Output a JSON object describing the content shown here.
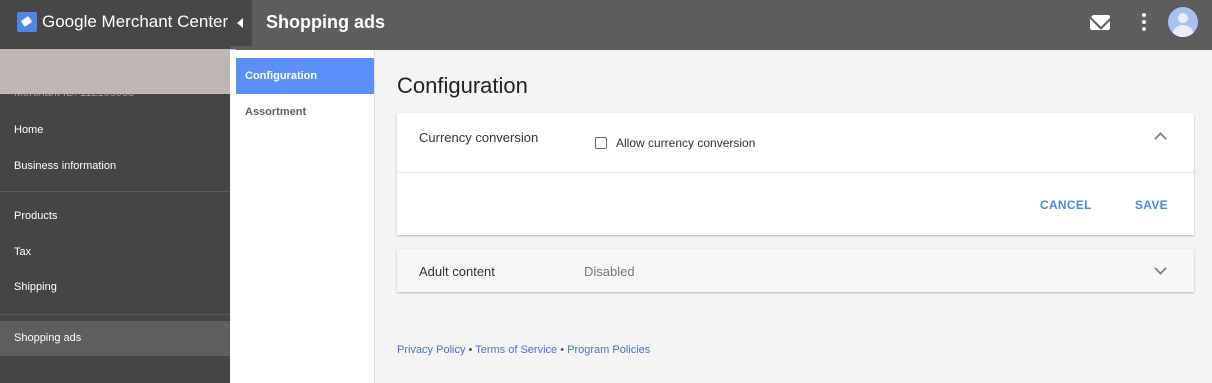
{
  "app": {
    "brand": "Google Merchant Center",
    "page_heading": "Shopping ads"
  },
  "account": {
    "id_text": "Merchant ID: 112199988"
  },
  "sidebar": {
    "items": [
      {
        "label": "Home"
      },
      {
        "label": "Business information"
      },
      {
        "label": "Products"
      },
      {
        "label": "Tax"
      },
      {
        "label": "Shipping"
      },
      {
        "label": "Shopping ads",
        "active": true
      }
    ]
  },
  "subnav": {
    "items": [
      {
        "label": "Configuration",
        "active": true
      },
      {
        "label": "Assortment"
      }
    ]
  },
  "main": {
    "title": "Configuration",
    "currency": {
      "label": "Currency conversion",
      "checkbox_label": "Allow currency conversion",
      "checked": false,
      "cancel_label": "CANCEL",
      "save_label": "SAVE"
    },
    "adult": {
      "label": "Adult content",
      "value": "Disabled"
    }
  },
  "footer": {
    "privacy": "Privacy Policy",
    "sep1": " • ",
    "terms": "Terms of Service",
    "sep2": " • ",
    "program": "Program Policies"
  },
  "icons": {
    "mail": "mail-icon",
    "more": "more-vert-icon",
    "avatar": "account-avatar-icon"
  },
  "colors": {
    "accent": "#4a86e8",
    "active_subnav": "#5b8ff9",
    "topbar": "#5d5d5d",
    "sidebar": "#454545"
  }
}
